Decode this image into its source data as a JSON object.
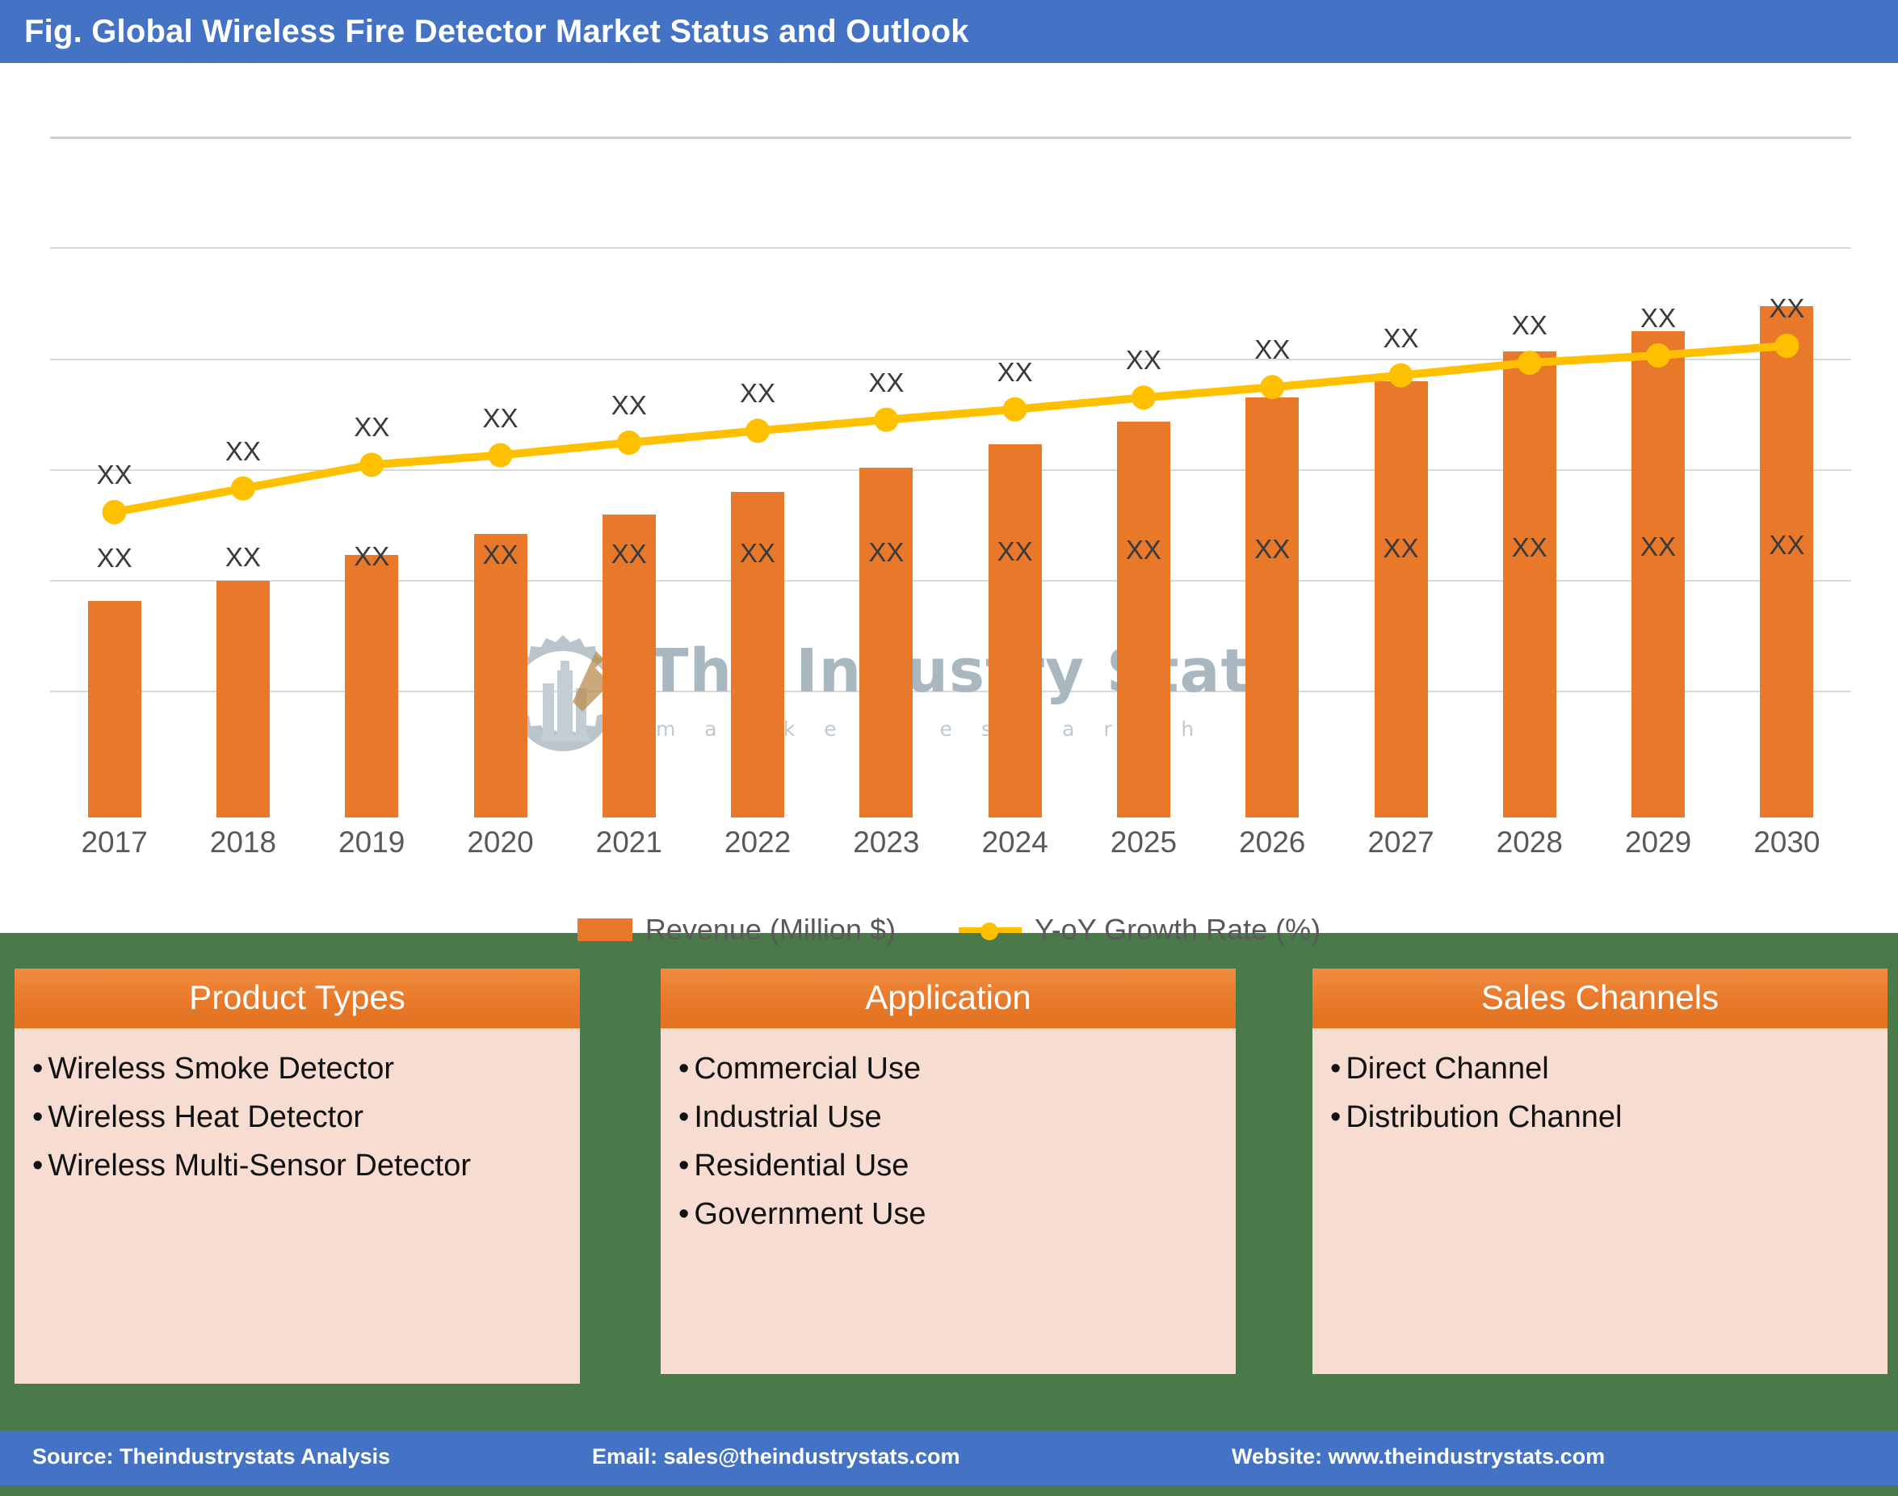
{
  "header": {
    "title": "Fig. Global Wireless Fire Detector Market Status and Outlook"
  },
  "watermark": {
    "brand": "The Industry Stats",
    "tagline": "m a r k e t     r e s e a r c h",
    "logo_icon": "gear-factory-wrench-logo"
  },
  "legend": {
    "items": [
      {
        "label": "Revenue (Million $)",
        "marker": "bar-swatch",
        "color": "#E8792B"
      },
      {
        "label": "Y-oY Growth Rate (%)",
        "marker": "line-marker",
        "color": "#FFC000"
      }
    ]
  },
  "cards": [
    {
      "title": "Product Types",
      "items": [
        "Wireless Smoke Detector",
        "Wireless Heat Detector",
        "Wireless Multi-Sensor Detector"
      ]
    },
    {
      "title": "Application",
      "items": [
        "Commercial Use",
        "Industrial Use",
        "Residential Use",
        "Government Use"
      ]
    },
    {
      "title": "Sales Channels",
      "items": [
        "Direct Channel",
        "Distribution Channel"
      ]
    }
  ],
  "footer": {
    "source": "Source: Theindustrystats Analysis",
    "email": "Email: sales@theindustrystats.com",
    "website": "Website: www.theindustrystats.com"
  },
  "chart_data": {
    "type": "bar",
    "title": "Fig. Global Wireless Fire Detector Market Status and Outlook",
    "xlabel": "",
    "ylabel": "",
    "grid": true,
    "legend_position": "bottom",
    "categories": [
      "2017",
      "2018",
      "2019",
      "2020",
      "2021",
      "2022",
      "2023",
      "2024",
      "2025",
      "2026",
      "2027",
      "2028",
      "2029",
      "2030"
    ],
    "series": [
      {
        "name": "Revenue (Million $)",
        "type": "bar",
        "color": "#E8792B",
        "values": [
          293,
          320,
          355,
          383,
          410,
          440,
          473,
          505,
          535,
          568,
          590,
          630,
          658,
          692
        ],
        "data_labels": [
          "XX",
          "XX",
          "XX",
          "XX",
          "XX",
          "XX",
          "XX",
          "XX",
          "XX",
          "XX",
          "XX",
          "XX",
          "XX",
          "XX"
        ]
      },
      {
        "name": "Y-oY Growth Rate (%)",
        "type": "line",
        "color": "#FFC000",
        "values": [
          413,
          445,
          477,
          490,
          507,
          523,
          538,
          552,
          568,
          582,
          598,
          615,
          625,
          638
        ],
        "data_labels": [
          "XX",
          "XX",
          "XX",
          "XX",
          "XX",
          "XX",
          "XX",
          "XX",
          "XX",
          "XX",
          "XX",
          "XX",
          "XX",
          "XX"
        ]
      }
    ],
    "ylim": [
      0,
      920
    ],
    "gridline_values": [
      920,
      770,
      620,
      470,
      320,
      170
    ]
  }
}
